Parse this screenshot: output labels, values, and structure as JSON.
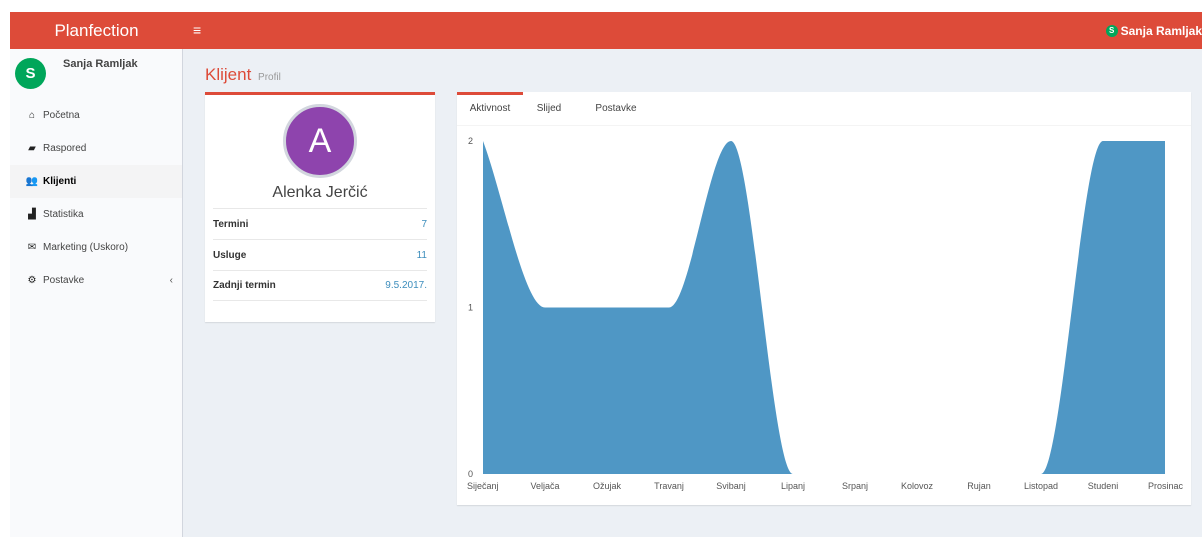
{
  "app": {
    "brand": "Planfection",
    "menu_toggle": "≡"
  },
  "user": {
    "name": "Sanja Ramljak",
    "initial": "S"
  },
  "sidebar": {
    "items": [
      {
        "label": "Početna",
        "icon": "home-icon",
        "glyph": "⌂"
      },
      {
        "label": "Raspored",
        "icon": "book-icon",
        "glyph": "▰"
      },
      {
        "label": "Klijenti",
        "icon": "users-icon",
        "glyph": "👥",
        "active": true
      },
      {
        "label": "Statistika",
        "icon": "area-chart-icon",
        "glyph": "▟"
      },
      {
        "label": "Marketing (Uskoro)",
        "icon": "envelope-icon",
        "glyph": "✉"
      },
      {
        "label": "Postavke",
        "icon": "cogs-icon",
        "glyph": "⚙",
        "chevron": "‹"
      }
    ]
  },
  "page": {
    "title": "Klijent",
    "subtitle": "Profil"
  },
  "client": {
    "initial": "A",
    "name": "Alenka Jerčić",
    "stats": [
      {
        "label": "Termini",
        "value": "7"
      },
      {
        "label": "Usluge",
        "value": "11"
      },
      {
        "label": "Zadnji termin",
        "value": "9.5.2017."
      }
    ]
  },
  "tabs": [
    {
      "label": "Aktivnost",
      "active": true
    },
    {
      "label": "Slijed",
      "active": false
    },
    {
      "label": "Postavke",
      "active": false
    }
  ],
  "colors": {
    "accent": "#dd4b39",
    "chart_fill": "#4f97c5",
    "avatar": "#8e44ad",
    "user_avatar": "#00a65a"
  },
  "chart_data": {
    "type": "area",
    "categories": [
      "Siječanj",
      "Veljača",
      "Ožujak",
      "Travanj",
      "Svibanj",
      "Lipanj",
      "Srpanj",
      "Kolovoz",
      "Rujan",
      "Listopad",
      "Studeni",
      "Prosinac"
    ],
    "values": [
      2,
      1,
      1,
      1,
      2,
      0,
      0,
      0,
      0,
      0,
      2,
      2
    ],
    "ylim": [
      0,
      2
    ],
    "yticks": [
      "0",
      "1",
      "2"
    ],
    "grid": false,
    "legend": "none"
  }
}
